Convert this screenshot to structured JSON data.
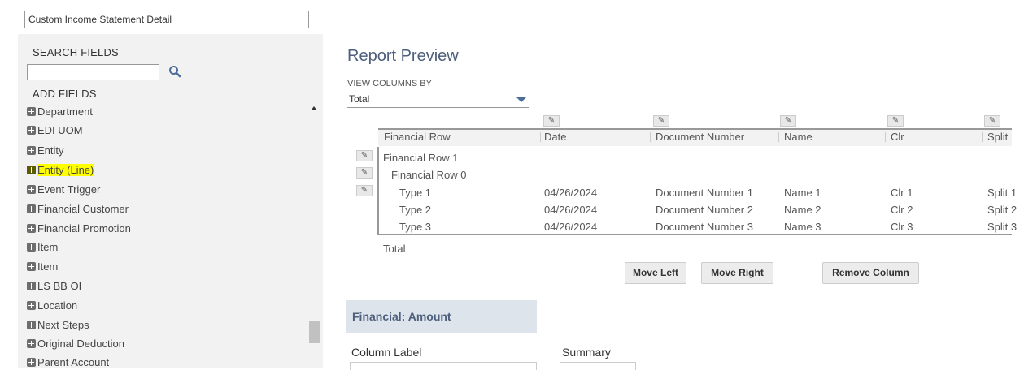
{
  "report_name": "Custom Income Statement Detail",
  "left": {
    "search_fields_label": "SEARCH FIELDS",
    "search_placeholder": "",
    "add_fields_label": "ADD FIELDS",
    "fields": [
      {
        "label": "Department"
      },
      {
        "label": "EDI UOM"
      },
      {
        "label": "Entity"
      },
      {
        "label": "Entity (Line)",
        "highlighted": true
      },
      {
        "label": "Event Trigger"
      },
      {
        "label": "Financial Customer"
      },
      {
        "label": "Financial Promotion"
      },
      {
        "label": "Item"
      },
      {
        "label": "Item"
      },
      {
        "label": "LS BB OI"
      },
      {
        "label": "Location"
      },
      {
        "label": "Next Steps"
      },
      {
        "label": "Original Deduction"
      },
      {
        "label": "Parent Account"
      }
    ]
  },
  "preview": {
    "title": "Report Preview",
    "view_columns_by_label": "VIEW COLUMNS BY",
    "view_columns_by_value": "Total",
    "columns": [
      "Financial Row",
      "Date",
      "Document Number",
      "Name",
      "Clr",
      "Split"
    ],
    "row_groups": [
      "Financial Row 1",
      "Financial Row 0"
    ],
    "rows": [
      {
        "type": "Type 1",
        "date": "04/26/2024",
        "doc": "Document Number 1",
        "name": "Name 1",
        "clr": "Clr 1",
        "split": "Split 1"
      },
      {
        "type": "Type 2",
        "date": "04/26/2024",
        "doc": "Document Number 2",
        "name": "Name 2",
        "clr": "Clr 2",
        "split": "Split 2"
      },
      {
        "type": "Type 3",
        "date": "04/26/2024",
        "doc": "Document Number 3",
        "name": "Name 3",
        "clr": "Clr 3",
        "split": "Split 3"
      }
    ],
    "total_label": "Total",
    "buttons": {
      "move_left": "Move Left",
      "move_right": "Move Right",
      "remove_column": "Remove Column"
    }
  },
  "column_settings": {
    "section_title": "Financial: Amount",
    "column_label": "Column Label",
    "summary_label": "Summary"
  }
}
